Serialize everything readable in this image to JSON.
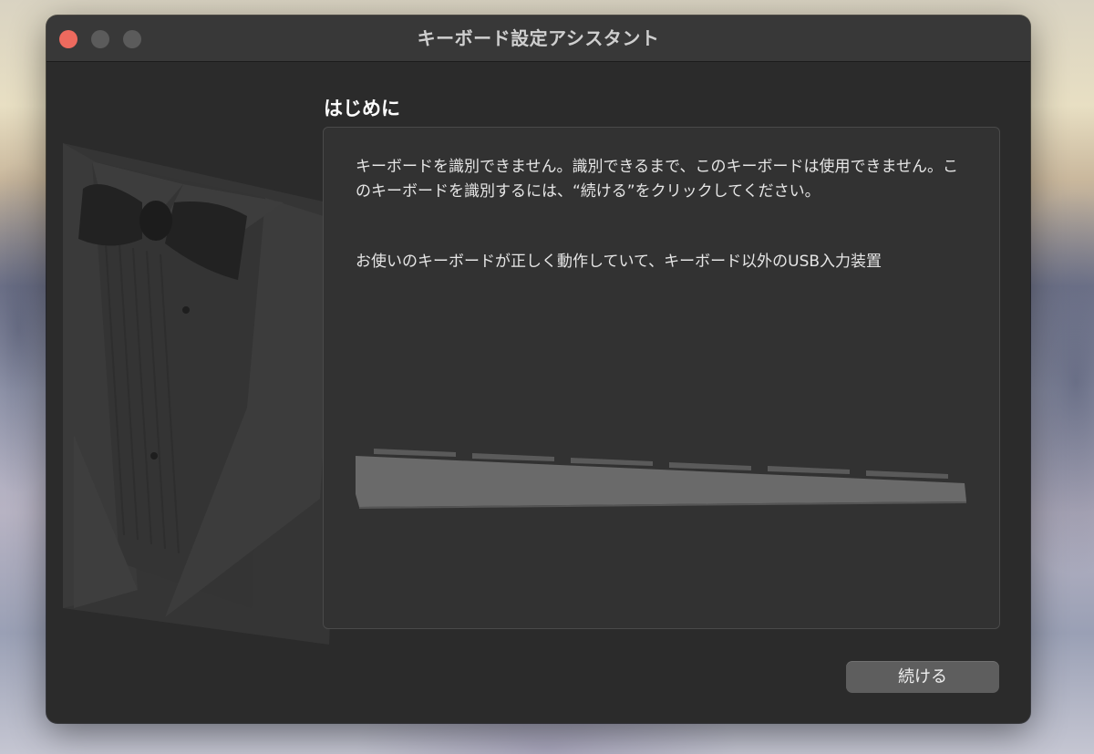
{
  "window": {
    "title": "キーボード設定アシスタント"
  },
  "content": {
    "heading": "はじめに",
    "paragraph1": "キーボードを識別できません。識別できるまで、このキーボードは使用できません。このキーボードを識別するには、“続ける”をクリックしてください。",
    "paragraph2": "お使いのキーボードが正しく動作していて、キーボード以外のUSB入力装置"
  },
  "buttons": {
    "continue_label": "続ける"
  },
  "icons": {
    "illustration": "tuxedo-bowtie-icon",
    "keyboard": "keyboard-icon",
    "close": "close-icon",
    "minimize": "minimize-icon",
    "zoom": "zoom-icon"
  },
  "colors": {
    "window_bg": "#2b2b2b",
    "titlebar_bg": "#383838",
    "close_button": "#ed6a5e",
    "button_bg": "#5e5e5e"
  }
}
